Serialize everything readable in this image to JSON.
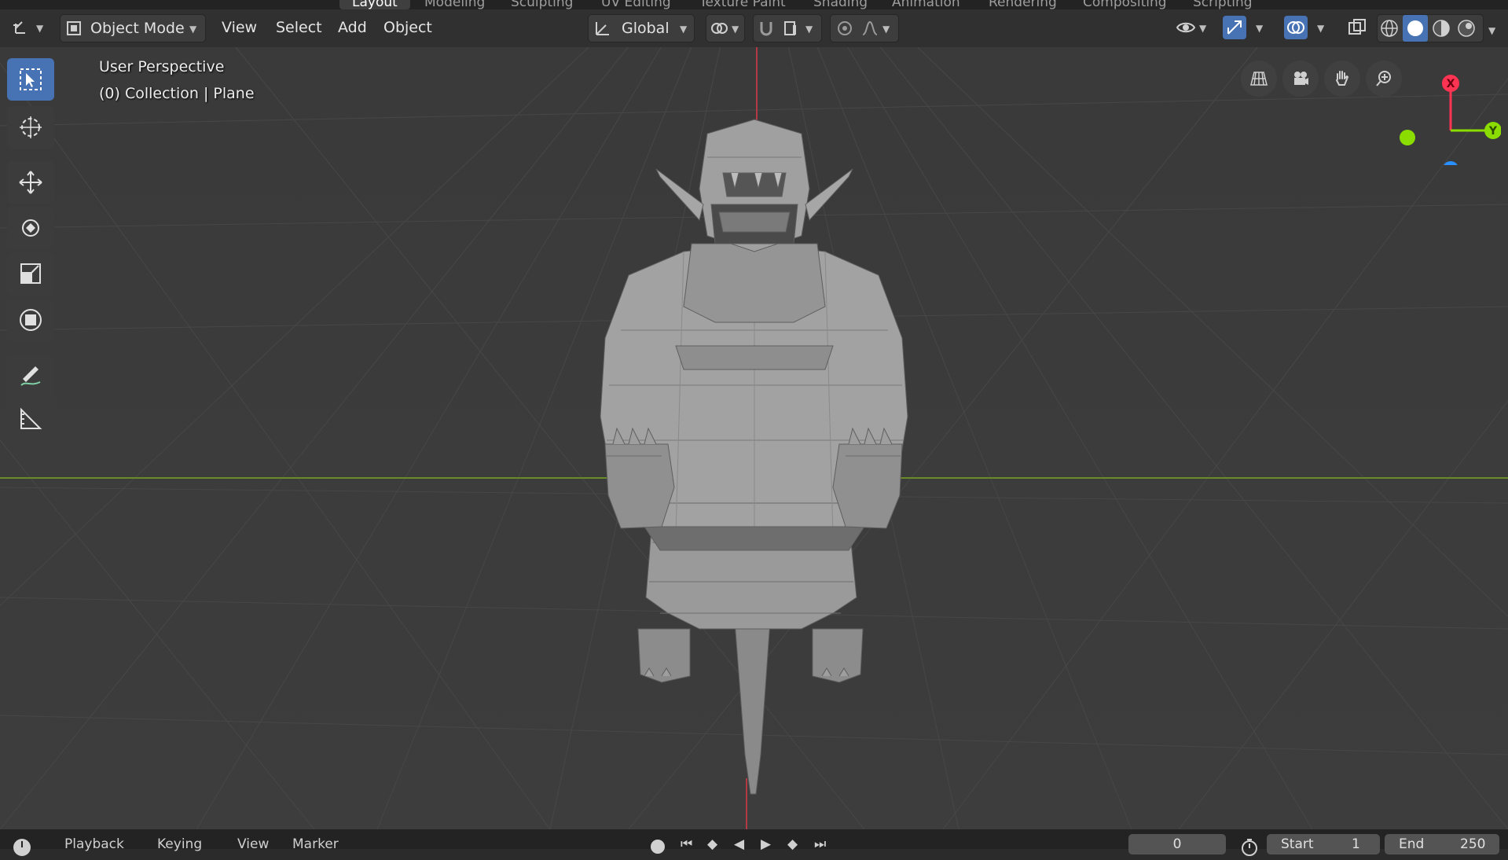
{
  "workspace_tabs": [
    {
      "label": "Layout",
      "active": true
    },
    {
      "label": "Modeling",
      "active": false
    },
    {
      "label": "Sculpting",
      "active": false
    },
    {
      "label": "UV Editing",
      "active": false
    },
    {
      "label": "Texture Paint",
      "active": false
    },
    {
      "label": "Shading",
      "active": false
    },
    {
      "label": "Animation",
      "active": false
    },
    {
      "label": "Rendering",
      "active": false
    },
    {
      "label": "Compositing",
      "active": false
    },
    {
      "label": "Scripting",
      "active": false
    }
  ],
  "header": {
    "mode": "Object Mode",
    "menus": [
      "View",
      "Select",
      "Add",
      "Object"
    ],
    "orientation": "Global"
  },
  "viewport": {
    "overlay_line1": "User Perspective",
    "overlay_line2": "(0) Collection | Plane"
  },
  "gizmo": {
    "x_label": "X",
    "y_label": "Y"
  },
  "timeline": {
    "playback": "Playback",
    "keying": "Keying",
    "view": "View",
    "marker": "Marker",
    "current_frame": "0",
    "start_label": "Start",
    "start_value": "1",
    "end_label": "End",
    "end_value": "250"
  },
  "colors": {
    "accent": "#4772b3",
    "x_axis": "#ff3352",
    "y_axis": "#8bdc00",
    "z_axis": "#2890ff"
  }
}
